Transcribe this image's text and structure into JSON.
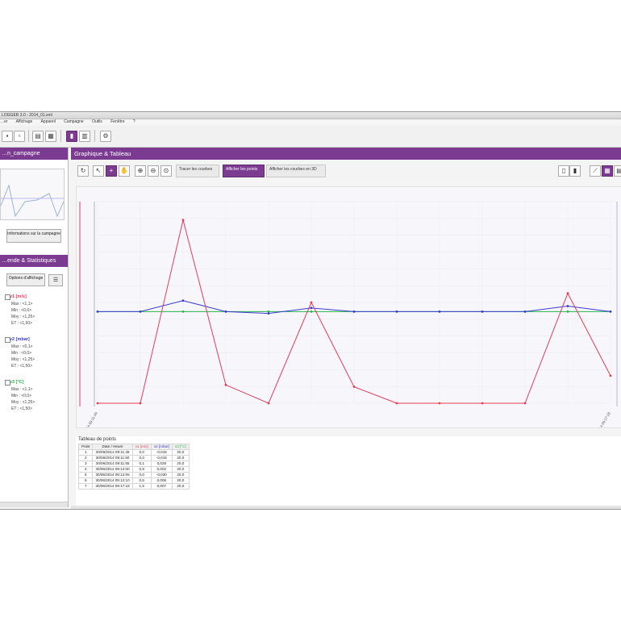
{
  "window": {
    "title": "LOGGER 3.0 - 2014_01.xml"
  },
  "menu": [
    "…er",
    "Affichage",
    "Appareil",
    "Campagne",
    "Outils",
    "Fenêtre",
    "?"
  ],
  "toolbar": {
    "icons": [
      "save-icon",
      "print-preview-icon",
      "document-icon",
      "print-icon",
      "chart-panel-icon",
      "table-panel-icon",
      "settings-icon"
    ]
  },
  "left_panel": {
    "campaign_title": "…n_campagne",
    "info_button": "Informations sur la campagne",
    "legend_title": "…ende & Statistiques",
    "options_button": "Options d'affichage",
    "series": [
      {
        "name": "v1 [m/s]",
        "color": "#e53b5a",
        "stats": [
          "Max : <1,1>",
          "Min : <0,0>",
          "Moy : <1,25>",
          "ET : <1,50>"
        ]
      },
      {
        "name": "v2 [mbar]",
        "color": "#3b3bd0",
        "stats": [
          "Max : <0,1>",
          "Min : <0,0>",
          "Moy : <1,25>",
          "ET : <1,50>"
        ]
      },
      {
        "name": "v3 [°C]",
        "color": "#27b24a",
        "stats": [
          "Max : <1,1>",
          "Min : <0,0>",
          "Moy : <1,25>",
          "ET : <1,50>"
        ]
      }
    ]
  },
  "main": {
    "title": "Graphique & Tableau",
    "tools": {
      "draw_curves": "Tracer les courbes",
      "show_points": "Afficher les points",
      "show_3d": "Afficher les courbes en 3D"
    }
  },
  "chart_data": {
    "type": "line",
    "x": [
      "30/06/2014 09:11:49",
      "",
      "",
      "",
      "",
      "",
      "",
      "",
      "",
      "",
      "",
      "",
      "30/06/2014 09:17:18"
    ],
    "series": [
      {
        "name": "v1 [m/s]",
        "color": "#e53b5a",
        "values": [
          0.0,
          0.0,
          1.0,
          0.1,
          0.0,
          0.55,
          0.09,
          0.0,
          0.0,
          0.0,
          0.0,
          0.6,
          0.15
        ]
      },
      {
        "name": "v2 [mbar]",
        "color": "#3b3bd0",
        "values": [
          0.5,
          0.5,
          0.56,
          0.5,
          0.49,
          0.52,
          0.5,
          0.5,
          0.5,
          0.5,
          0.5,
          0.53,
          0.5
        ]
      },
      {
        "name": "v3 [°C]",
        "color": "#27b24a",
        "values": [
          0.5,
          0.5,
          0.5,
          0.5,
          0.5,
          0.5,
          0.5,
          0.5,
          0.5,
          0.5,
          0.5,
          0.5,
          0.5
        ]
      }
    ],
    "ylim": [
      0,
      1.1
    ]
  },
  "points_table": {
    "title": "Tableau de points",
    "headers": [
      "Point",
      "Date / Heure",
      "v1 [m/s]",
      "v2 [mbar]",
      "v3 [°C]"
    ],
    "rows": [
      [
        "1",
        "30/06/2014 09:11:49",
        "0,0",
        "-0,015",
        "20,0"
      ],
      [
        "2",
        "30/06/2014 09:11:50",
        "0,0",
        "-0,015",
        "20,0"
      ],
      [
        "3",
        "30/06/2014 09:11:55",
        "0,1",
        "0,026",
        "20,0"
      ],
      [
        "4",
        "30/06/2014 09:12:00",
        "0,8",
        "0,002",
        "20,0"
      ],
      [
        "5",
        "30/06/2014 09:12:05",
        "0,0",
        "-0,030",
        "20,0"
      ],
      [
        "6",
        "30/06/2014 09:12:10",
        "0,5",
        "0,006",
        "20,0"
      ],
      [
        "7",
        "30/06/2014 09:17:18",
        "1,5",
        "0,007",
        "20,0"
      ]
    ]
  }
}
